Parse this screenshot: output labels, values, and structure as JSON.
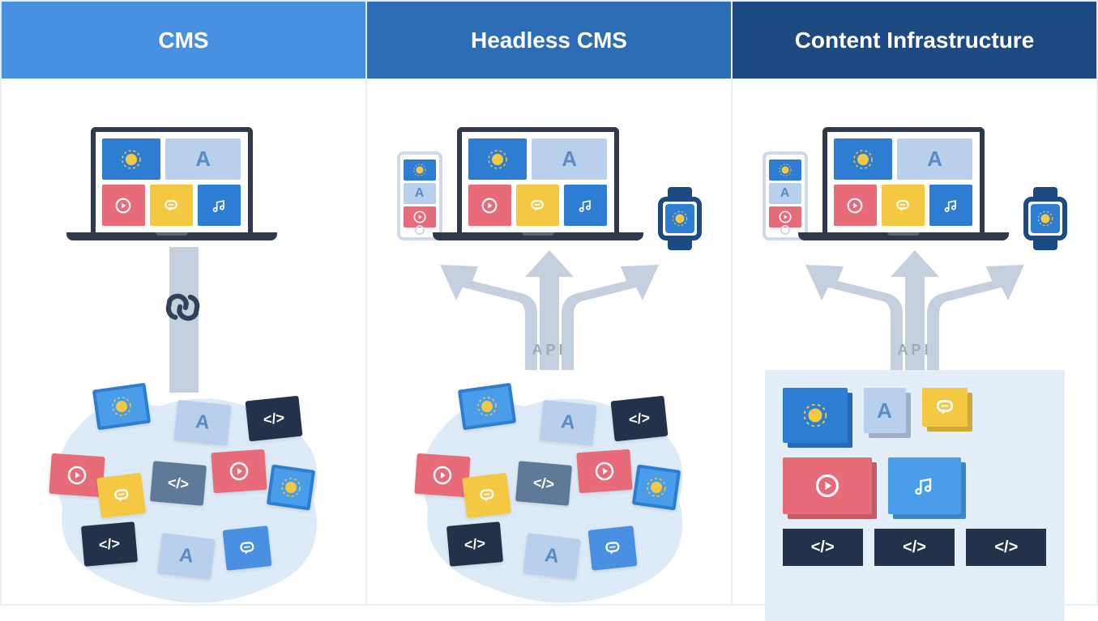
{
  "columns": [
    {
      "title": "CMS",
      "connector": "chain"
    },
    {
      "title": "Headless CMS",
      "connector": "api",
      "api_label": "API"
    },
    {
      "title": "Content Infrastructure",
      "connector": "api",
      "api_label": "API"
    }
  ],
  "icons": {
    "letter_a": "A",
    "code": "</>",
    "play": "play",
    "chat": "chat",
    "music": "music",
    "sun": "sun"
  },
  "devices": {
    "laptop_tiles": [
      "sun",
      "A",
      "play",
      "chat",
      "music"
    ],
    "phone_tiles": [
      "sun",
      "A",
      "play"
    ],
    "watch_tile": "sun"
  },
  "cloud_cards": [
    "sun",
    "A",
    "code",
    "play",
    "chat",
    "code",
    "play",
    "sun",
    "code",
    "A",
    "chat"
  ],
  "panel": {
    "row1": [
      "sun",
      "A",
      "chat"
    ],
    "row2": [
      "play",
      "music"
    ],
    "row3": [
      "code",
      "code",
      "code"
    ]
  }
}
